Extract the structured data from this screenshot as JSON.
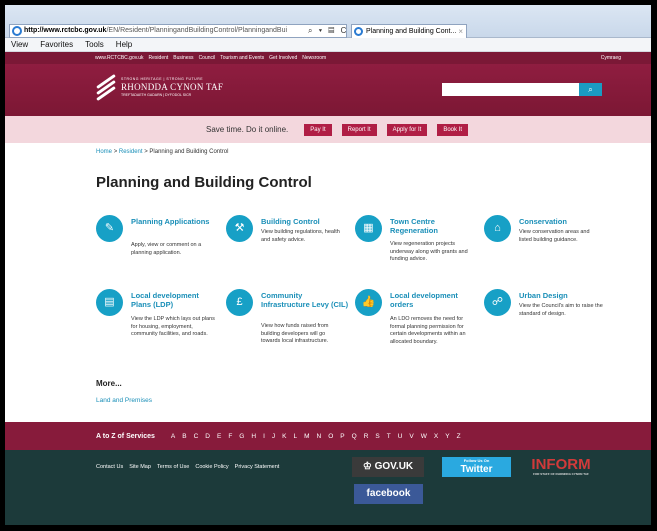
{
  "browser": {
    "address_host": "http://www.rctcbc.gov.uk",
    "address_path": "/EN/Resident/PlanningandBuildingControl/PlanningandBui",
    "address_tools": "⌕ ▾ ▤ C ✕",
    "tab_title": "Planning and Building Cont...",
    "tab_close": "×",
    "menu": [
      "View",
      "Favorites",
      "Tools",
      "Help"
    ]
  },
  "utility_nav": {
    "items": [
      "www.RCTCBC.gov.uk",
      "Resident",
      "Business",
      "Council",
      "Tourism and Events",
      "Get Involved",
      "Newsroom"
    ],
    "welsh": "Cymraeg"
  },
  "logo": {
    "tag": "STRONG HERITAGE | STRONG FUTURE",
    "name": "RHONDDA CYNON TAF",
    "sub": "TREFTADAETH GADARN | DYFODOL SICR"
  },
  "search": {
    "placeholder": "",
    "icon": "search-icon"
  },
  "promo": {
    "text": "Save time. Do it online.",
    "buttons": [
      "Pay It",
      "Report It",
      "Apply for It",
      "Book It"
    ]
  },
  "breadcrumb": {
    "home": "Home",
    "sep": ">",
    "resident": "Resident",
    "current": "Planning and Building Control"
  },
  "page_title": "Planning and Building Control",
  "services": [
    {
      "title": "Planning Applications",
      "desc": "Apply, view or comment on a planning application.",
      "icon": "edit-icon",
      "glyph": "✎"
    },
    {
      "title": "Building Control",
      "desc": "View building regulations, health and safety advice.",
      "icon": "presenter-icon",
      "glyph": "⚒"
    },
    {
      "title": "Town Centre Regeneration",
      "desc": "View regeneration projects underway along with grants and funding advice.",
      "icon": "buildings-icon",
      "glyph": "▦"
    },
    {
      "title": "Conservation",
      "desc": "View conservation areas and listed building guidance.",
      "icon": "capitol-icon",
      "glyph": "⌂"
    },
    {
      "title": "Local development Plans (LDP)",
      "desc": "View the LDP which lays out plans for housing, employment, community facilities, and roads.",
      "icon": "document-icon",
      "glyph": "▤"
    },
    {
      "title": "Community Infrastructure Levy (CIL)",
      "desc": "View how funds raised from building developers will go towards local infrastructure.",
      "icon": "money-icon",
      "glyph": "£"
    },
    {
      "title": "Local development orders",
      "desc": "An LDO removes the need for formal planning permission for certain developments within an allocated boundary.",
      "icon": "thumbs-up-icon",
      "glyph": "👍"
    },
    {
      "title": "Urban Design",
      "desc": "View the Council's aim to raise the standard of design.",
      "icon": "network-icon",
      "glyph": "☍"
    }
  ],
  "more": {
    "heading": "More...",
    "link": "Land and Premises"
  },
  "a_to_z": {
    "label": "A to Z of Services",
    "letters": [
      "A",
      "B",
      "C",
      "D",
      "E",
      "F",
      "G",
      "H",
      "I",
      "J",
      "K",
      "L",
      "M",
      "N",
      "O",
      "P",
      "Q",
      "R",
      "S",
      "T",
      "U",
      "V",
      "W",
      "X",
      "Y",
      "Z"
    ]
  },
  "footer": {
    "links": [
      "Contact Us",
      "Site Map",
      "Terms of Use",
      "Cookie Policy",
      "Privacy Statement"
    ],
    "gov": "♔ GOV.UK",
    "twitter_small": "Follow Us On",
    "twitter": "Twitter",
    "inform": "INFORM",
    "inform_sub": "FOR STAFF OF RHONDDA CYNON TAF",
    "facebook": "facebook"
  },
  "colors": {
    "maroon": "#7b1836",
    "accent": "#17a0c6",
    "footer": "#1c3a3a",
    "promo_bg": "#f3d7dd",
    "promo_btn": "#b01e45"
  }
}
